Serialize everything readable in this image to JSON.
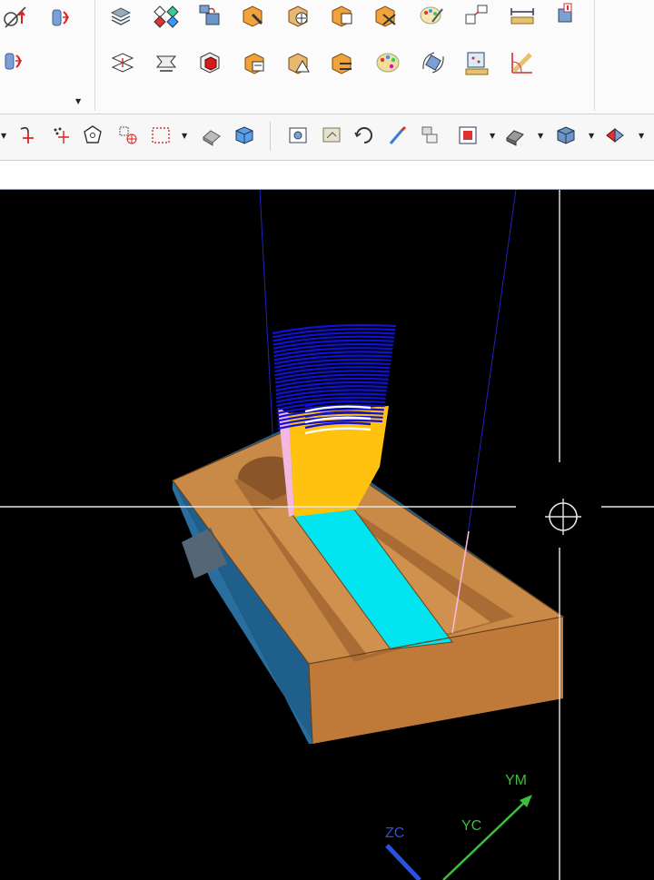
{
  "ribbon": {
    "left_group": [
      "mirror-tool",
      "extrude-tool",
      "extrude-tool"
    ],
    "row1": [
      "layer-stack-tool",
      "feature-color-tool",
      "assembly-tool",
      "block-pencil-tool",
      "block-move-tool",
      "block-copy-tool",
      "block-delete-tool",
      "paint-tool",
      "snap-tool",
      "measure-distance-tool",
      "section-tool"
    ],
    "row2": [
      "flatten-tool",
      "offset-surface-tool",
      "red-cube-tool",
      "block-edit-tool",
      "block-triangle-tool",
      "block-swap-tool",
      "palette-tool",
      "rotate-view-tool",
      "surface-measure-tool",
      "angle-measure-tool"
    ]
  },
  "toolbar": {
    "left": [
      "snap-point-tool",
      "point-set-tool",
      "polygon-tool",
      "point-filter-tool",
      "select-box-tool",
      "eraser-tool",
      "blue-cube-tool"
    ],
    "right": [
      "fit-view-tool",
      "pan-view-tool",
      "rotate-tool",
      "paint-brush-tool",
      "layer-props-tool",
      "display-mode-tool",
      "render-style-tool",
      "shaded-cube-tool",
      "view-orient-tool"
    ]
  },
  "viewport": {
    "axes": {
      "zc_label": "ZC",
      "yc_label": "YC",
      "ym_label": "YM",
      "zc_color": "#2a52e0",
      "yc_color": "#3cbf3c"
    },
    "colors": {
      "background": "#000000",
      "part_top": "#c98a48",
      "part_side": "#1e5f8c",
      "floor": "#00e5f0",
      "tool_holder": "#ffc20e",
      "tool_shank": "#f4b8e0",
      "toolpath": "#1010d8"
    }
  }
}
